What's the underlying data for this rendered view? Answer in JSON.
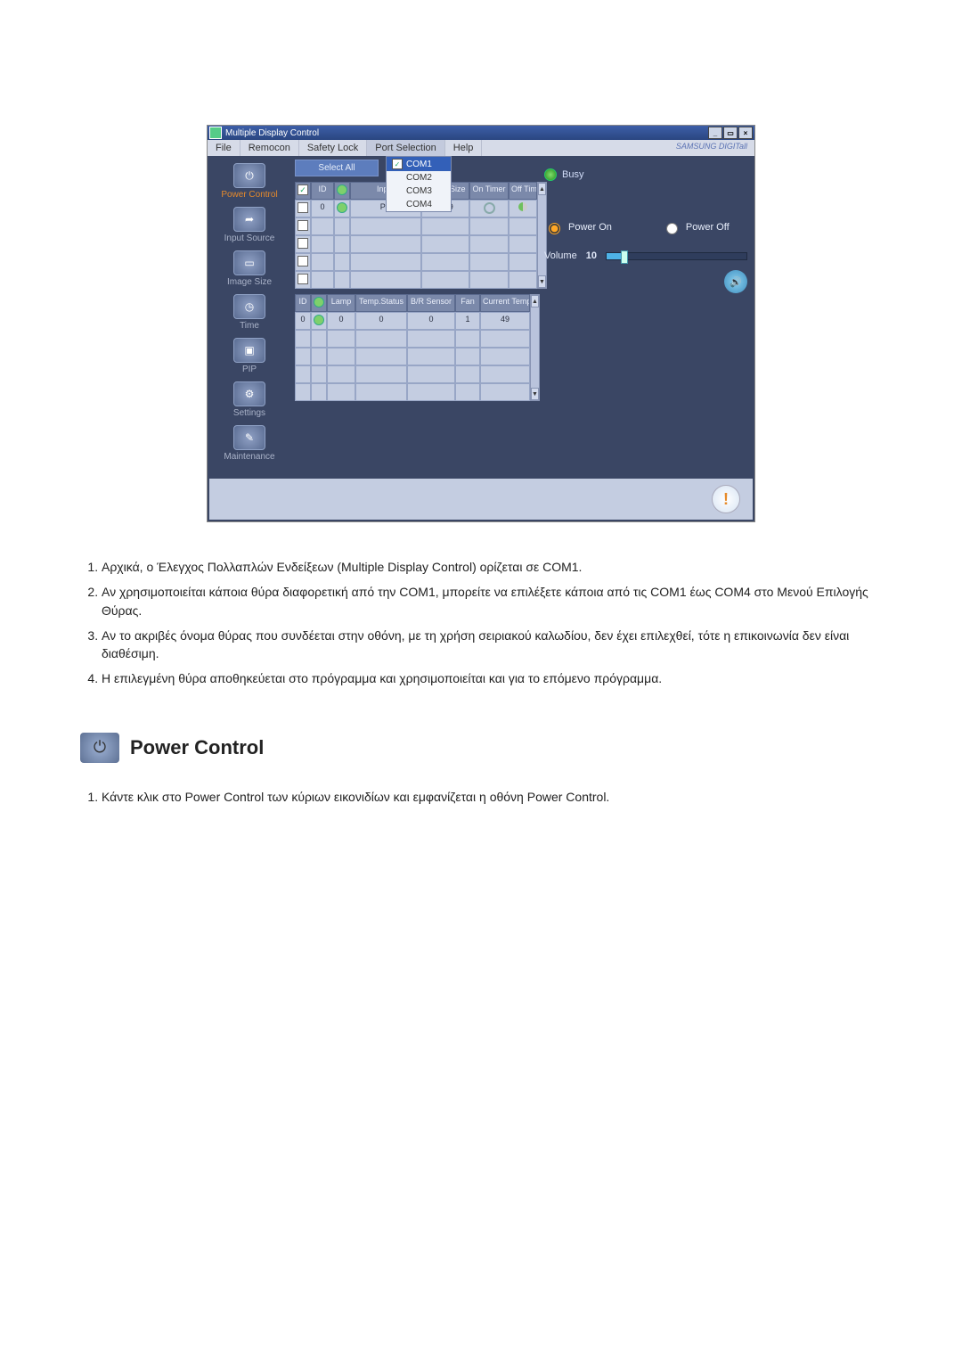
{
  "window": {
    "title": "Multiple Display Control",
    "brand": "SAMSUNG DIGITall"
  },
  "menu": {
    "file": "File",
    "remocon": "Remocon",
    "safety": "Safety Lock",
    "port": "Port Selection",
    "help": "Help"
  },
  "port_dropdown": [
    "COM1",
    "COM2",
    "COM3",
    "COM4"
  ],
  "sidebar": {
    "items": [
      {
        "label": "Power Control",
        "active": true
      },
      {
        "label": "Input Source",
        "active": false
      },
      {
        "label": "Image Size",
        "active": false
      },
      {
        "label": "Time",
        "active": false
      },
      {
        "label": "PIP",
        "active": false
      },
      {
        "label": "Settings",
        "active": false
      },
      {
        "label": "Maintenance",
        "active": false
      }
    ]
  },
  "toolbar": {
    "select_all": "Select All"
  },
  "busy_label": "Busy",
  "grid1": {
    "headers": [
      "",
      "ID",
      "",
      "Input",
      "Image Size",
      "On Timer",
      "Off Timer"
    ],
    "row": {
      "id": "0",
      "input": "PC",
      "image_size": "16:9"
    }
  },
  "grid2": {
    "headers": [
      "ID",
      "",
      "Lamp",
      "Temp.Status",
      "B/R Sensor",
      "Fan",
      "Current Temp."
    ],
    "row": {
      "id": "0",
      "lamp": "0",
      "temp_status": "0",
      "br": "0",
      "fan": "1",
      "cur": "49"
    }
  },
  "right": {
    "power_on": "Power On",
    "power_off": "Power Off",
    "volume_label": "Volume",
    "volume_value": "10"
  },
  "notes": [
    "Αρχικά, ο Έλεγχος Πολλαπλών Ενδείξεων (Multiple Display Control) ορίζεται σε COM1.",
    "Αν χρησιμοποιείται κάποια θύρα διαφορετική από την COM1, μπορείτε να επιλέξετε κάποια από τις COM1 έως COM4 στο Μενού Επιλογής Θύρας.",
    "Αν το ακριβές όνομα θύρας που συνδέεται στην οθόνη, με τη χρήση σειριακού καλωδίου, δεν έχει επιλεχθεί, τότε η επικοινωνία δεν είναι διαθέσιμη.",
    "Η επιλεγμένη θύρα αποθηκεύεται στο πρόγραμμα και χρησιμοποιείται και για το επόμενο πρόγραμμα."
  ],
  "section": {
    "title": "Power Control",
    "body": "Κάντε κλικ στο Power Control των κύριων εικονιδίων και εμφανίζεται η οθόνη Power Control."
  }
}
